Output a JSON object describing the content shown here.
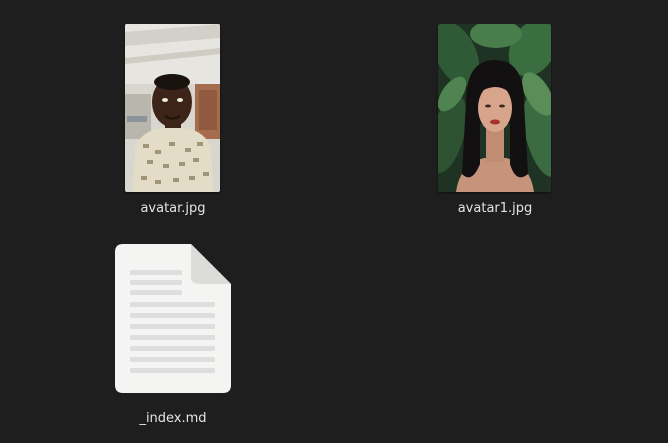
{
  "files": [
    {
      "name": "avatar.jpg",
      "type": "image",
      "icon": "image-thumbnail"
    },
    {
      "name": "avatar1.jpg",
      "type": "image",
      "icon": "image-thumbnail"
    },
    {
      "name": "_index.md",
      "type": "text",
      "icon": "text-document-icon"
    }
  ],
  "colors": {
    "background": "#1e1e1e",
    "label": "#e4e4e4",
    "doc_page": "#f4f4f2",
    "doc_fold": "#dcdcda",
    "doc_lines": "#dedede"
  }
}
